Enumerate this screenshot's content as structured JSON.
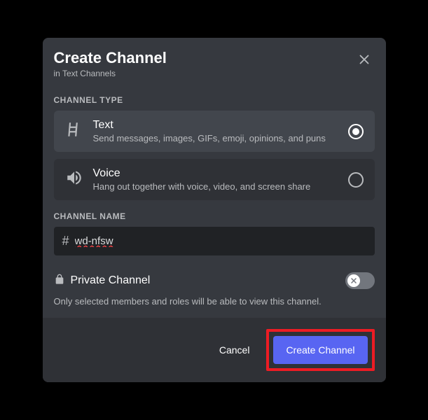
{
  "modal": {
    "title": "Create Channel",
    "subtitle": "in Text Channels"
  },
  "channelType": {
    "label": "CHANNEL TYPE",
    "options": [
      {
        "title": "Text",
        "desc": "Send messages, images, GIFs, emoji, opinions, and puns",
        "selected": true
      },
      {
        "title": "Voice",
        "desc": "Hang out together with voice, video, and screen share",
        "selected": false
      }
    ]
  },
  "channelName": {
    "label": "CHANNEL NAME",
    "prefix": "#",
    "value": "wd-nfsw"
  },
  "private": {
    "title": "Private Channel",
    "desc": "Only selected members and roles will be able to view this channel.",
    "enabled": false
  },
  "footer": {
    "cancel": "Cancel",
    "create": "Create Channel"
  }
}
